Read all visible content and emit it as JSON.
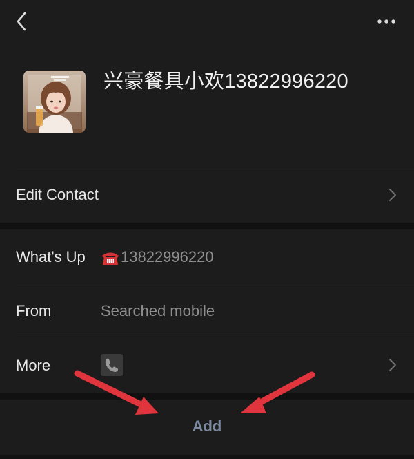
{
  "header": {
    "back_icon": "chevron-left-icon",
    "more_icon": "ellipsis-icon"
  },
  "contact": {
    "name": "兴豪餐具小欢13822996220",
    "avatar": "contact-photo"
  },
  "edit_row": {
    "label": "Edit Contact"
  },
  "info_rows": {
    "whats_up_label": "What's Up",
    "whats_up_value": "13822996220",
    "whats_up_icon": "telephone-emoji-icon",
    "from_label": "From",
    "from_value": "Searched mobile",
    "more_label": "More",
    "more_icon": "phone-icon"
  },
  "add_button": {
    "label": "Add"
  },
  "annotations": {
    "arrow_color": "#e0353d"
  },
  "colors": {
    "background": "#111111",
    "panel": "#1c1c1c",
    "secondary_text": "#8f8f8f",
    "add_text": "#7c8aa1"
  }
}
